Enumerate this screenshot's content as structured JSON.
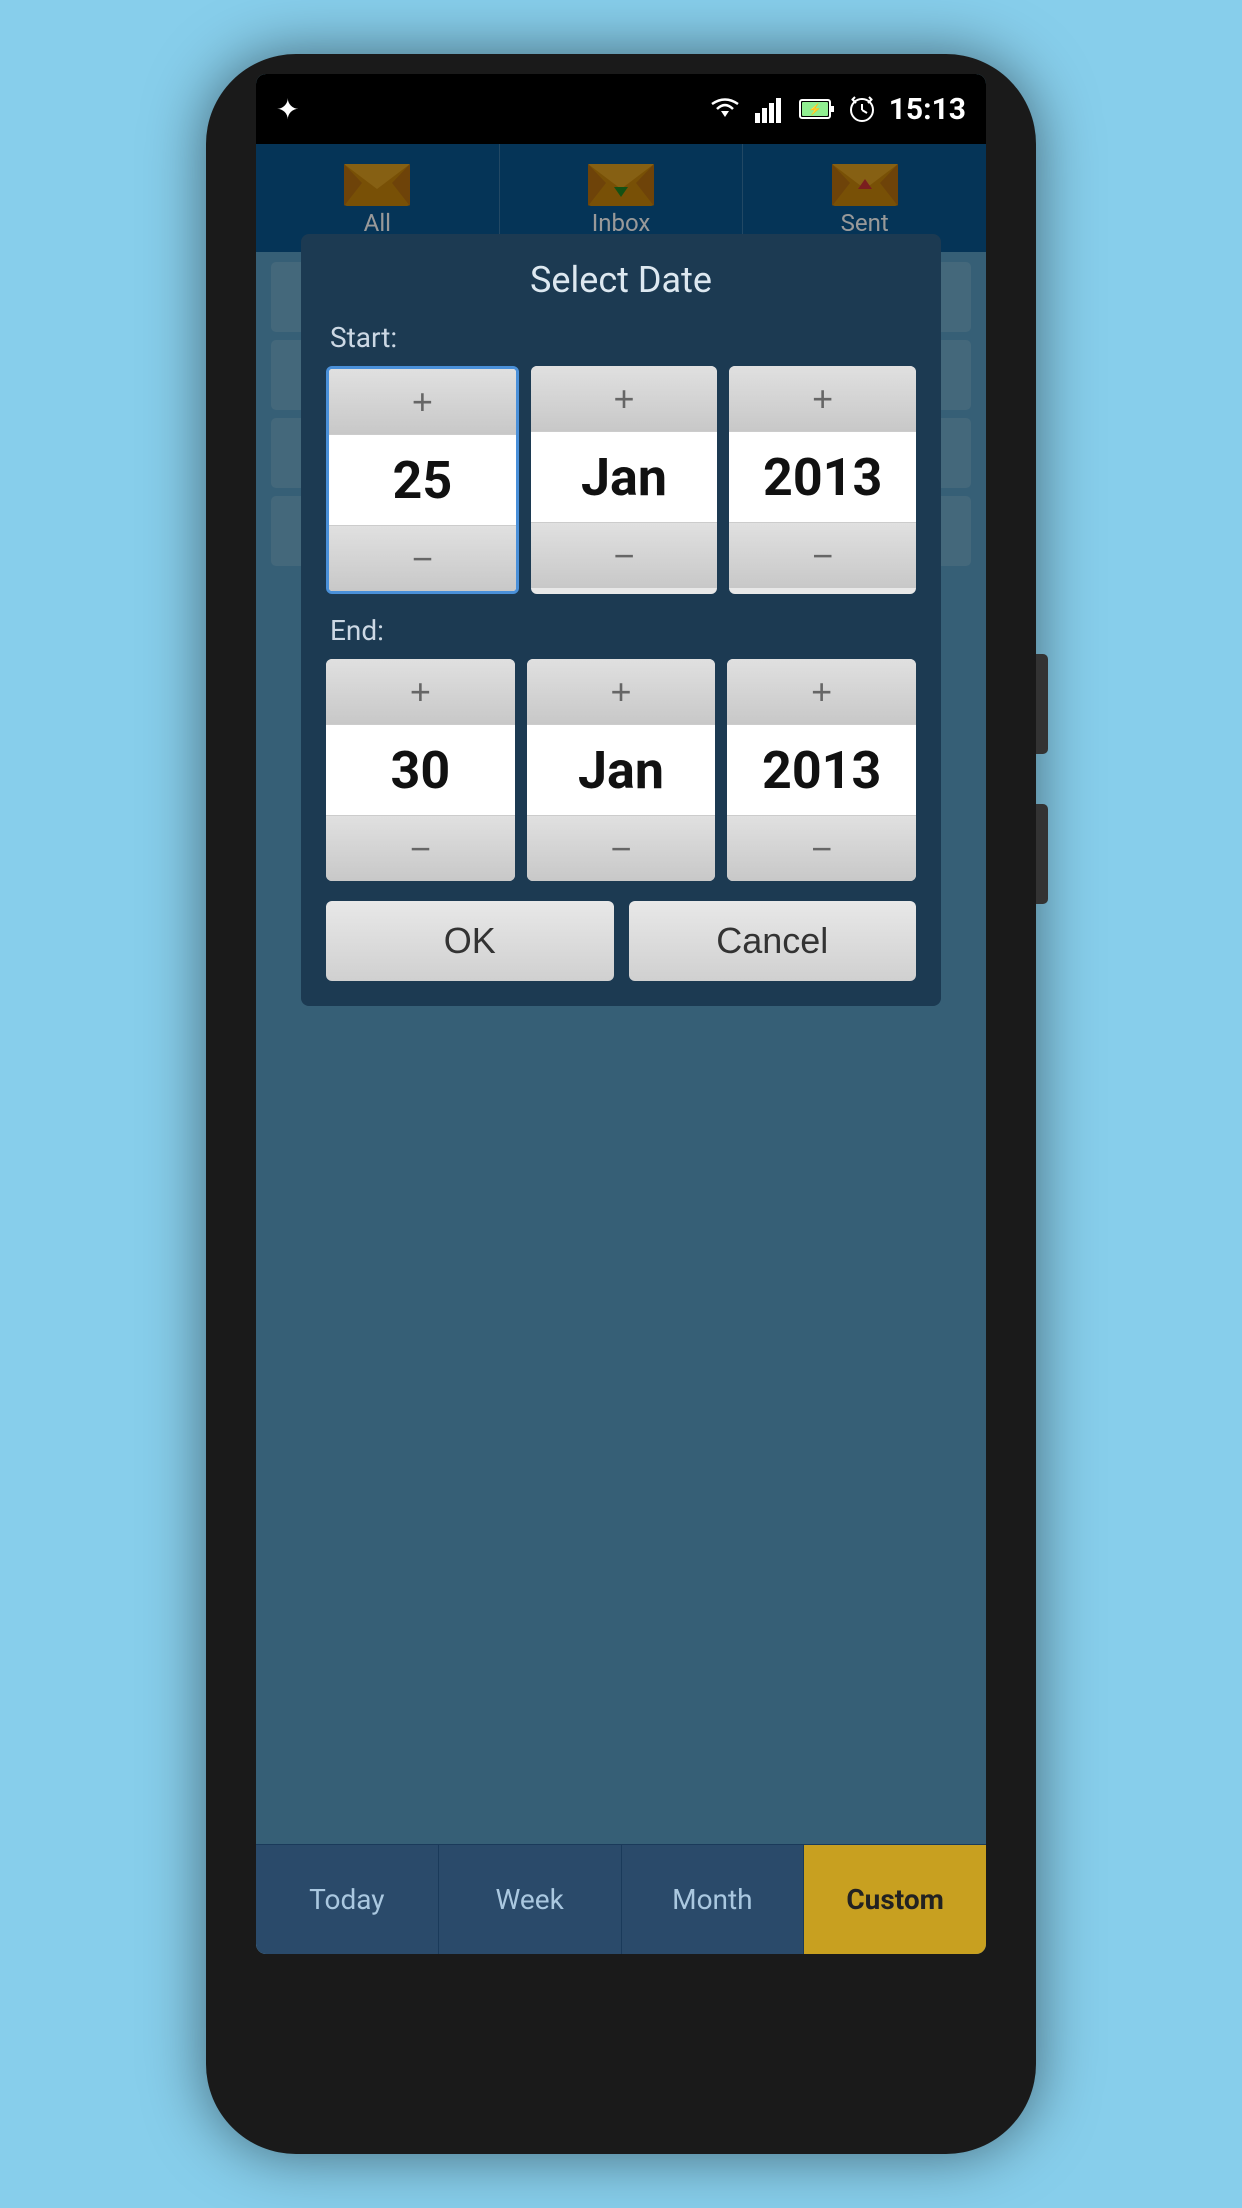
{
  "status_bar": {
    "time": "15:13",
    "usb_icon": "⚡",
    "wifi_icon": "wifi",
    "signal_icon": "signal",
    "battery_icon": "battery",
    "alarm_icon": "alarm"
  },
  "tabs": [
    {
      "label": "All",
      "icon": "envelope-all"
    },
    {
      "label": "Inbox",
      "icon": "envelope-inbox"
    },
    {
      "label": "Sent",
      "icon": "envelope-sent"
    }
  ],
  "dialog": {
    "title": "Select Date",
    "start_label": "Start:",
    "end_label": "End:",
    "start": {
      "day": "25",
      "month": "Jan",
      "year": "2013"
    },
    "end": {
      "day": "30",
      "month": "Jan",
      "year": "2013"
    },
    "ok_label": "OK",
    "cancel_label": "Cancel"
  },
  "bottom_nav": {
    "items": [
      {
        "label": "Today"
      },
      {
        "label": "Week"
      },
      {
        "label": "Month"
      },
      {
        "label": "Custom"
      }
    ]
  }
}
